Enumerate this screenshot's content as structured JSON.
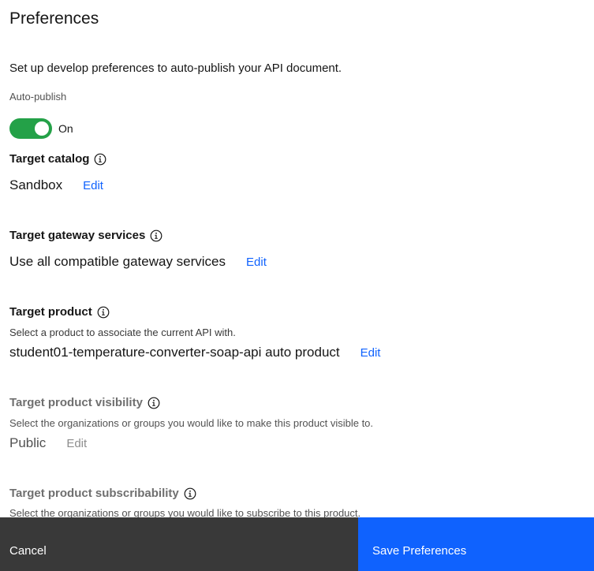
{
  "header": {
    "title": "Preferences"
  },
  "description": "Set up develop preferences to auto-publish your API document.",
  "auto_publish": {
    "label": "Auto-publish",
    "state": "On",
    "enabled": true,
    "accent": "#24a148"
  },
  "sections": {
    "catalog": {
      "heading": "Target catalog",
      "value": "Sandbox",
      "edit": "Edit"
    },
    "gateway": {
      "heading": "Target gateway services",
      "value": "Use all compatible gateway services",
      "edit": "Edit"
    },
    "product": {
      "heading": "Target product",
      "helper": "Select a product to associate the current API with.",
      "value": "student01-temperature-converter-soap-api auto product",
      "edit": "Edit"
    },
    "visibility": {
      "heading": "Target product visibility",
      "helper": "Select the organizations or groups you would like to make this product visible to.",
      "value": "Public",
      "edit": "Edit"
    },
    "subscribability": {
      "heading": "Target product subscribability",
      "helper": "Select the organizations or groups you would like to subscribe to this product."
    }
  },
  "footer": {
    "cancel_label": "Cancel",
    "save_label": "Save Preferences"
  },
  "colors": {
    "link": "#0f62fe",
    "save_bg": "#0f62fe",
    "cancel_bg": "#393939"
  }
}
